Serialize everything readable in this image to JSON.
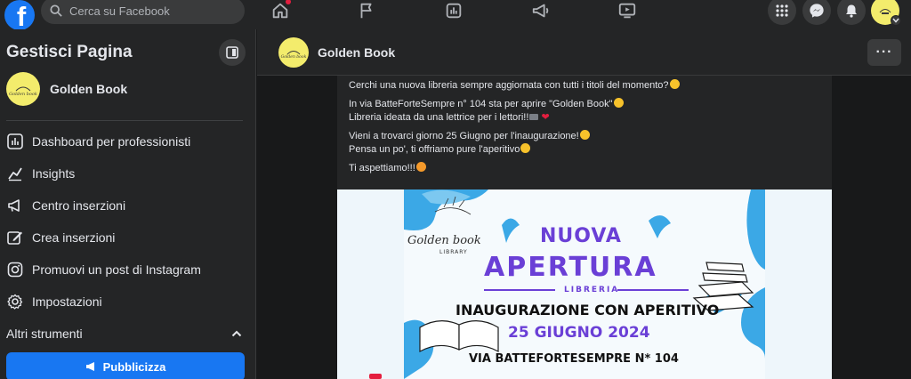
{
  "topbar": {
    "logo": "f",
    "search_placeholder": "Cerca su Facebook",
    "nav_icons": [
      "home-icon",
      "flag-icon",
      "insights-icon",
      "megaphone-icon",
      "video-icon"
    ],
    "right_icons": [
      "menu-grid-icon",
      "messenger-icon",
      "bell-icon"
    ]
  },
  "sidebar": {
    "title": "Gestisci Pagina",
    "page_name": "Golden Book",
    "items": [
      {
        "label": "Dashboard per professionisti",
        "icon": "dashboard-icon"
      },
      {
        "label": "Insights",
        "icon": "insights-icon"
      },
      {
        "label": "Centro inserzioni",
        "icon": "megaphone-icon"
      },
      {
        "label": "Crea inserzioni",
        "icon": "edit-icon"
      },
      {
        "label": "Promuovi un post di Instagram",
        "icon": "instagram-icon"
      },
      {
        "label": "Impostazioni",
        "icon": "gear-icon"
      }
    ],
    "section_label": "Altri strumenti",
    "promote_label": "Pubblicizza"
  },
  "header": {
    "page_name": "Golden Book",
    "more_label": "···"
  },
  "post": {
    "line1": "Cerchi una nuova libreria sempre aggiornata con tutti i titoli del momento?",
    "line2": "In via BatteForteSempre n° 104 sta per aprire \"Golden Book\"",
    "line3": "Libreria ideata da una lettrice per i lettori!!",
    "line4": "Vieni a trovarci giorno 25 Giugno per l'inaugurazione!",
    "line5": "Pensa un po', ti offriamo pure l'aperitivo",
    "line6": "Ti aspettiamo!!!"
  },
  "flyer": {
    "logo_text": "Golden book",
    "logo_sub": "LIBRARY",
    "nuova": "NUOVA",
    "apertura": "APERTURA",
    "libreria": "LIBRERIA",
    "inaugurazione": "INAUGURAZIONE CON APERITIVO",
    "date": "25 GIUGNO 2024",
    "address": "VIA BATTEFORTESEMPRE N* 104"
  },
  "colors": {
    "brand_blue": "#1877f2",
    "flyer_purple": "#6a3fd6",
    "flyer_splash": "#3ba8e6",
    "avatar_yellow": "#f3ec6c"
  }
}
